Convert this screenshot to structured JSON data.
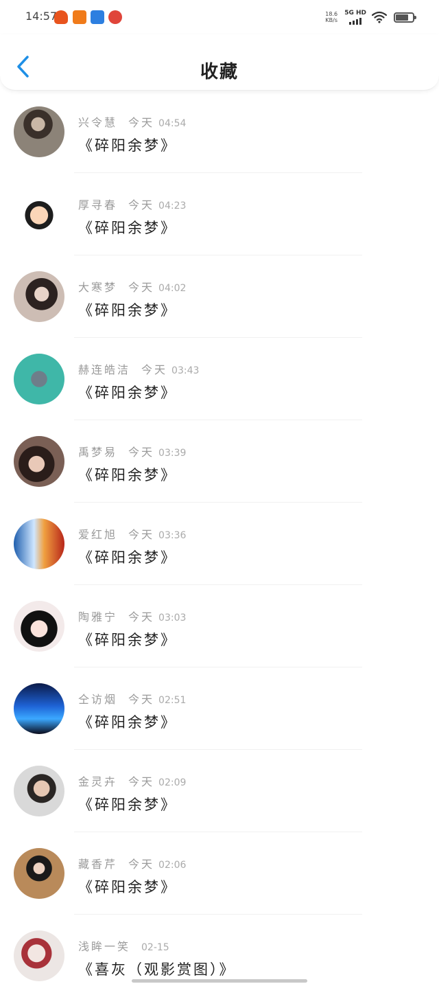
{
  "status_bar": {
    "time": "14:57",
    "net_speed_value": "18.6",
    "net_speed_unit": "KB/s",
    "network_type": "5G HD",
    "notification_icons": [
      "taobao-app-icon",
      "meituan-app-icon",
      "pdd-app-icon",
      "weibo-app-icon"
    ]
  },
  "header": {
    "title": "收藏",
    "back_icon": "chevron-left-icon",
    "accent_color": "#1e8fe6"
  },
  "items": [
    {
      "name": "兴令慧",
      "day": "今天",
      "time": "04:54",
      "title": "《碎阳余梦》"
    },
    {
      "name": "厚寻春",
      "day": "今天",
      "time": "04:23",
      "title": "《碎阳余梦》"
    },
    {
      "name": "大寒梦",
      "day": "今天",
      "time": "04:02",
      "title": "《碎阳余梦》"
    },
    {
      "name": "赫连皓洁",
      "day": "今天",
      "time": "03:43",
      "title": "《碎阳余梦》"
    },
    {
      "name": "禹梦易",
      "day": "今天",
      "time": "03:39",
      "title": "《碎阳余梦》"
    },
    {
      "name": "爱红旭",
      "day": "今天",
      "time": "03:36",
      "title": "《碎阳余梦》"
    },
    {
      "name": "陶雅宁",
      "day": "今天",
      "time": "03:03",
      "title": "《碎阳余梦》"
    },
    {
      "name": "仝访烟",
      "day": "今天",
      "time": "02:51",
      "title": "《碎阳余梦》"
    },
    {
      "name": "金灵卉",
      "day": "今天",
      "time": "02:09",
      "title": "《碎阳余梦》"
    },
    {
      "name": "藏香芹",
      "day": "今天",
      "time": "02:06",
      "title": "《碎阳余梦》"
    },
    {
      "name": "浅眸一笑",
      "time": "02-15",
      "title": "《喜灰（观影赏图）》"
    }
  ]
}
